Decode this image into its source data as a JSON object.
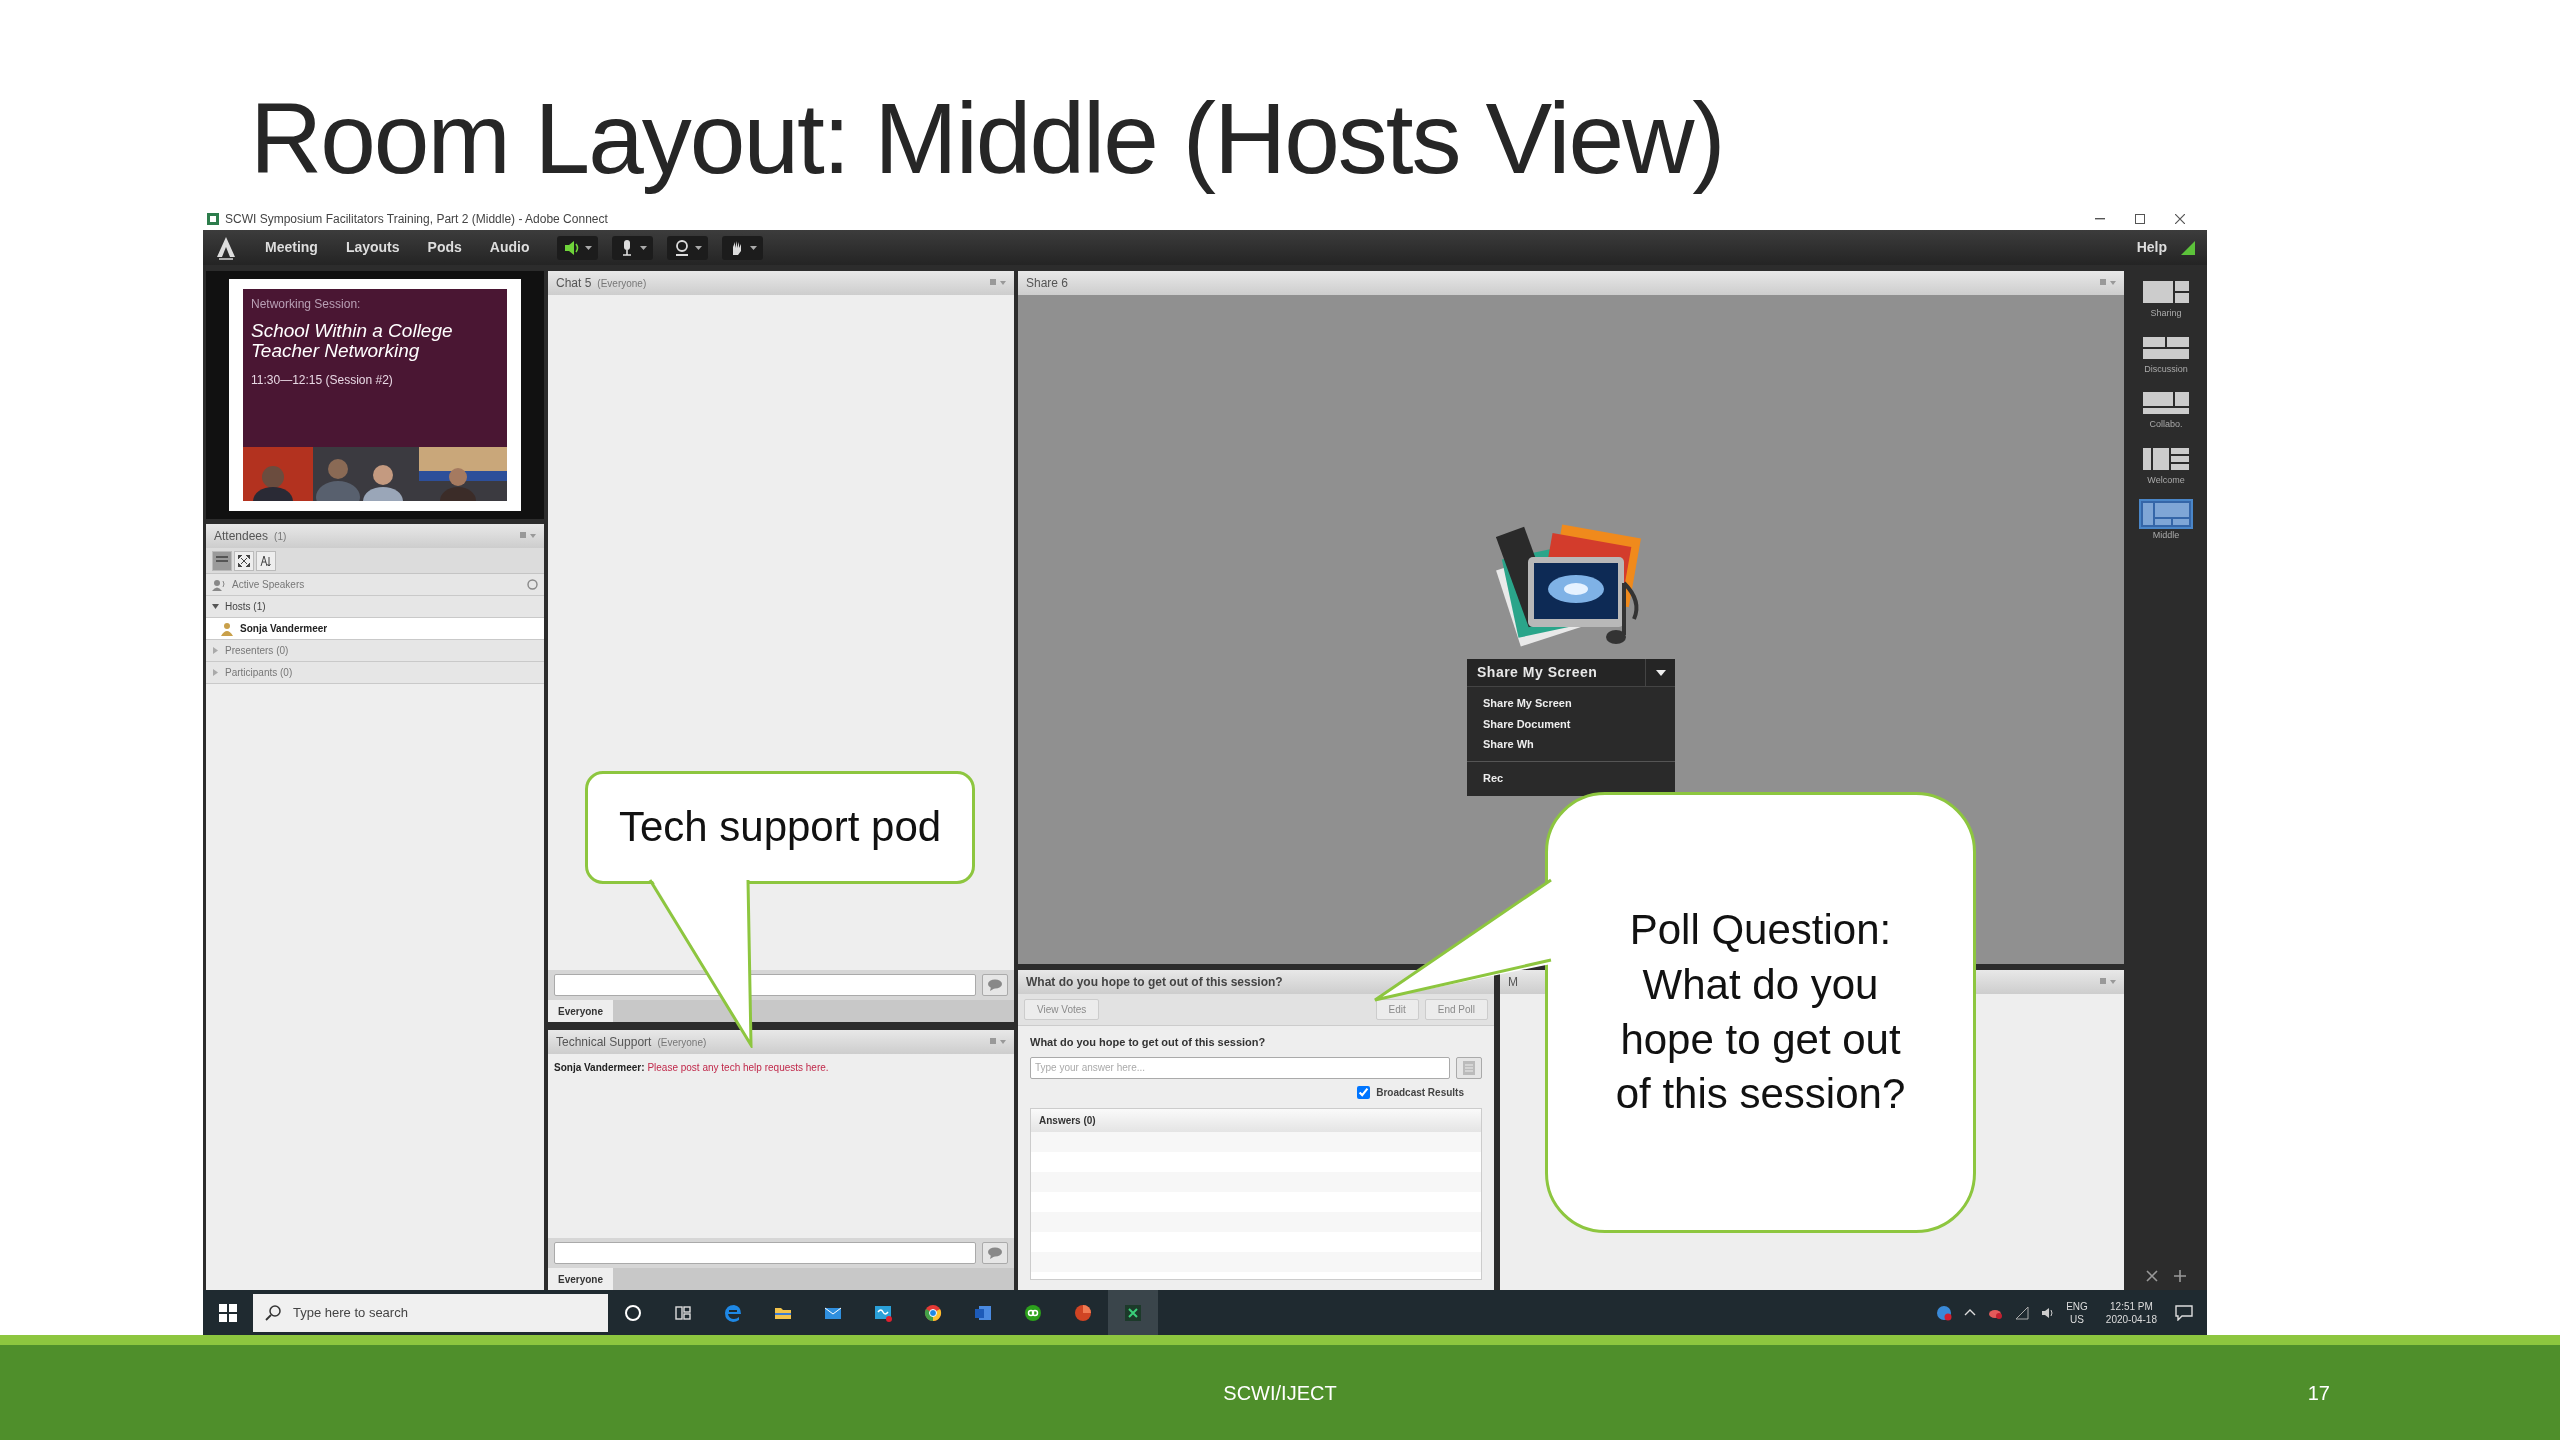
{
  "slide": {
    "title": "Room Layout: Middle (Hosts View)",
    "footer": "SCWI/IJECT",
    "page_number": "17"
  },
  "window": {
    "title": "SCWI Symposium Facilitators Training, Part 2 (Middle) - Adobe Connect",
    "menu": [
      "Meeting",
      "Layouts",
      "Pods",
      "Audio"
    ],
    "help": "Help"
  },
  "slide_pod": {
    "eyebrow": "Networking Session:",
    "title": "School Within a College Teacher Networking",
    "time": "11:30—12:15 (Session #2)"
  },
  "attendees": {
    "title": "Attendees",
    "count": "(1)",
    "active_speakers": "Active Speakers",
    "groups": [
      {
        "label": "Hosts (1)",
        "expanded": true,
        "children": [
          {
            "name": "Sonja Vandermeer"
          }
        ]
      },
      {
        "label": "Presenters (0)",
        "expanded": false
      },
      {
        "label": "Participants (0)",
        "expanded": false
      }
    ]
  },
  "chat": {
    "title": "Chat 5",
    "audience": "(Everyone)",
    "tab": "Everyone"
  },
  "tech_support": {
    "title": "Technical Support",
    "audience": "(Everyone)",
    "messages": [
      {
        "sender": "Sonja Vandermeer:",
        "text": "Please post any tech help requests here."
      }
    ],
    "tab": "Everyone"
  },
  "share": {
    "title": "Share 6",
    "button": "Share My Screen",
    "menu": [
      "Share My Screen",
      "Share Document",
      "Share Wh",
      "Rec"
    ]
  },
  "poll": {
    "title": "What do you hope to get out of this session?",
    "buttons": [
      {
        "label": "View Votes",
        "disabled": true
      },
      {
        "label": "Edit",
        "disabled": true
      },
      {
        "label": "End Poll",
        "disabled": true
      }
    ],
    "question": "What do you hope to get out of this session?",
    "placeholder": "Type your answer here...",
    "broadcast": {
      "label": "Broadcast Results",
      "checked": true
    },
    "answers": "Answers (0)"
  },
  "notes_pod": {
    "title": "M"
  },
  "layouts": [
    {
      "label": "Sharing",
      "selected": false
    },
    {
      "label": "Discussion",
      "selected": false
    },
    {
      "label": "Collabo.",
      "selected": false
    },
    {
      "label": "Welcome",
      "selected": false
    },
    {
      "label": "Middle",
      "selected": true
    }
  ],
  "taskbar": {
    "placeholder": "Type here to search",
    "language": "ENG",
    "region": "US",
    "time": "12:51 PM",
    "date": "2020-04-18"
  },
  "callouts": [
    {
      "text": "Tech support pod"
    },
    {
      "text": "Poll Question: What do you hope to get out of this session?"
    }
  ]
}
